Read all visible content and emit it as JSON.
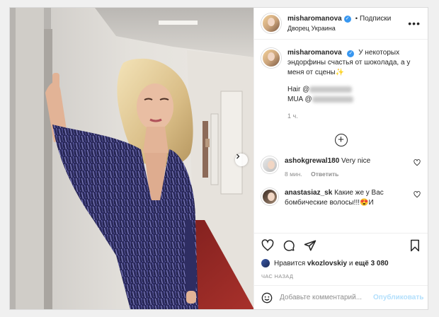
{
  "post": {
    "username": "misharomanova",
    "follow_label": "Подписки",
    "location": "Дворец Украина",
    "more_label": "•••",
    "caption_text": "У некоторых эндорфины счастья от шоколада, а у меня от сцены✨",
    "hair_label": "Hair @",
    "mua_label": "MUA @",
    "caption_time": "1 ч."
  },
  "load_more_symbol": "+",
  "comments": [
    {
      "username": "ashokgrewal180",
      "text": "Very nice",
      "time": "8 мин.",
      "reply_label": "Ответить"
    },
    {
      "username": "anastasiaz_sk",
      "text": "Какие же у Вас бомбические волосы!!!😍И",
      "time": "",
      "reply_label": ""
    }
  ],
  "likes": {
    "prefix": "Нравится",
    "user": "vkozlovskiy",
    "middle": "и",
    "count": "ещё 3 080"
  },
  "timestamp": "ЧАС НАЗАД",
  "comment_input": {
    "placeholder": "Добавьте комментарий...",
    "publish_label": "Опубликовать"
  },
  "icons": {
    "more": "more-icon",
    "next": "chevron-right-icon",
    "like": "heart-icon",
    "comment": "comment-icon",
    "share": "share-icon",
    "save": "bookmark-icon",
    "emoji": "emoji-icon",
    "verified": "verified-badge-icon"
  },
  "colors": {
    "link_blue": "#3897f0",
    "publish_disabled": "#b2dffc",
    "muted_text": "#8e8e8e",
    "dress": "#3d3a78"
  }
}
